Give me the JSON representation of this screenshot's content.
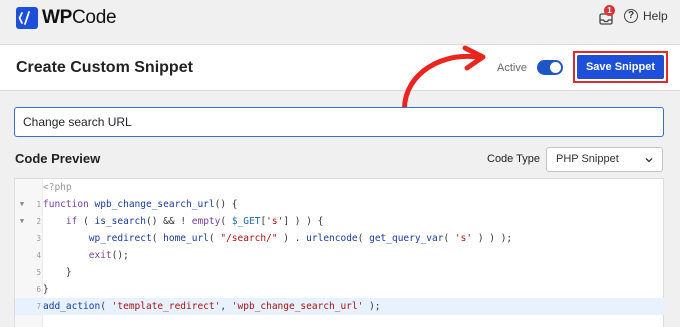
{
  "app": {
    "logo_bold": "WP",
    "logo_light": "Code",
    "notification_count": "1",
    "help_label": "Help"
  },
  "header": {
    "title": "Create Custom Snippet",
    "active_label": "Active",
    "toggle_on": true,
    "save_label": "Save Snippet"
  },
  "snippet": {
    "title_value": "Change search URL",
    "preview_label": "Code Preview",
    "code_type_label": "Code Type",
    "code_type_value": "PHP Snippet"
  },
  "code_lines": [
    {
      "num": "",
      "fold": false,
      "text": "<?php"
    },
    {
      "num": "1",
      "fold": true,
      "text": "function wpb_change_search_url() {"
    },
    {
      "num": "2",
      "fold": true,
      "text": "    if ( is_search() && ! empty( $_GET['s'] ) ) {"
    },
    {
      "num": "3",
      "fold": false,
      "text": "        wp_redirect( home_url( \"/search/\" ) . urlencode( get_query_var( 's' ) ) );"
    },
    {
      "num": "4",
      "fold": false,
      "text": "        exit();"
    },
    {
      "num": "5",
      "fold": false,
      "text": "    }"
    },
    {
      "num": "6",
      "fold": false,
      "text": "}"
    },
    {
      "num": "7",
      "fold": false,
      "text": "add_action( 'template_redirect', 'wpb_change_search_url' );"
    }
  ],
  "colors": {
    "brand_blue": "#1d4fd8",
    "highlight_red": "#e02b2b",
    "badge_red": "#d63638"
  },
  "icons": {
    "logo": "wpcode-logo-icon",
    "notifications": "inbox-icon",
    "help": "question-circle-icon",
    "dropdown": "chevron-down-icon",
    "fold": "fold-triangle-icon",
    "arrow": "annotation-arrow-icon"
  }
}
